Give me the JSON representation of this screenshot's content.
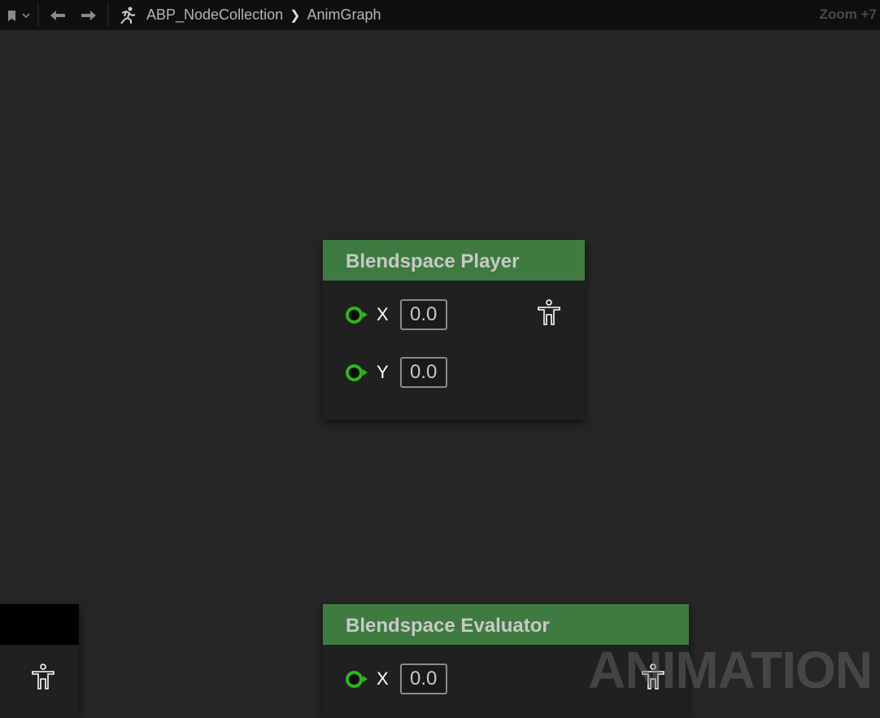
{
  "toolbar": {
    "breadcrumb": [
      "ABP_NodeCollection",
      "AnimGraph"
    ],
    "zoom_label": "Zoom +7"
  },
  "nodes": [
    {
      "title": "Blendspace Player",
      "pins": [
        {
          "label": "X",
          "value": "0.0"
        },
        {
          "label": "Y",
          "value": "0.0"
        }
      ]
    },
    {
      "title": "Blendspace Evaluator",
      "pins": [
        {
          "label": "X",
          "value": "0.0"
        }
      ]
    }
  ],
  "watermark": "ANIMATION",
  "colors": {
    "node_header": "#3f7b41",
    "pin": "#2fb41f",
    "canvas": "#262626"
  }
}
